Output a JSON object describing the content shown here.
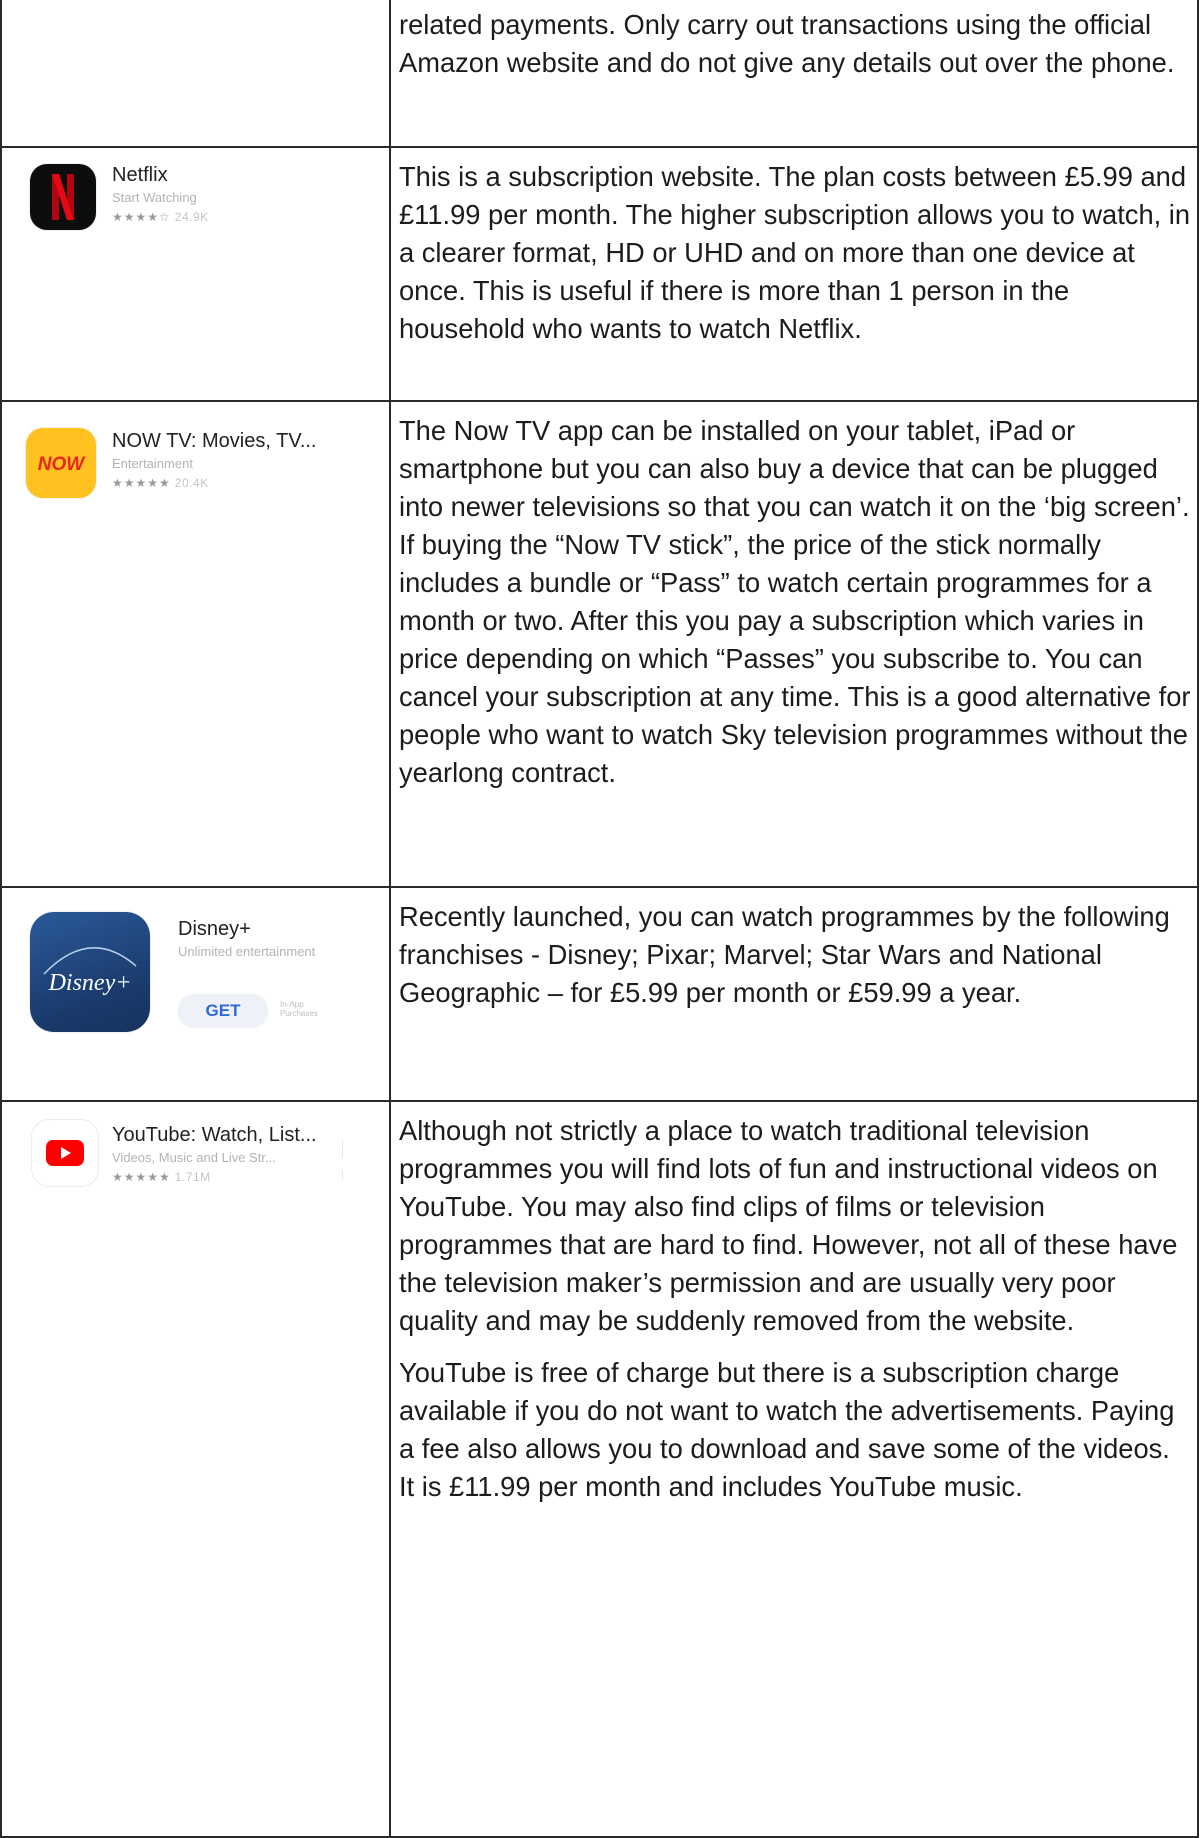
{
  "rows": [
    {
      "paragraphs": [
        "related payments.  Only carry out transactions using the official Amazon website and do not give any details out over the phone."
      ]
    },
    {
      "app": {
        "name": "Netflix",
        "subtitle": "Start Watching",
        "stars": "★★★★☆",
        "rating_count": "24.9K",
        "icon": "netflix-logo",
        "icon_color": "#0d0d0d",
        "accent": "#e50914"
      },
      "paragraphs": [
        "This is a subscription website.  The plan costs between £5.99 and £11.99 per month.  The higher subscription allows you to watch, in a clearer format, HD or UHD and on more than one device at once.  This is useful if there is more than 1 person in the household who wants to watch Netflix."
      ]
    },
    {
      "app": {
        "name": "NOW TV: Movies, TV...",
        "subtitle": "Entertainment",
        "stars": "★★★★★",
        "rating_count": "20.4K",
        "icon": "now-tv-logo",
        "icon_text": "NOW",
        "icon_color": "#ffc21f",
        "accent": "#e8251f"
      },
      "paragraphs": [
        "The Now TV app can be installed on your tablet, iPad or smartphone but you can also buy a device that can be plugged into newer televisions so that you can watch it on the ‘big screen’.  If buying the “Now TV stick”, the price of the stick normally includes a bundle or “Pass” to watch certain programmes for a month or two.  After this you pay a subscription which varies in price depending on which “Passes” you subscribe to.  You can cancel your subscription at any time.  This is a good alternative for people who want to watch Sky television programmes without the yearlong contract."
      ]
    },
    {
      "app": {
        "name": "Disney+",
        "subtitle": "Unlimited entertainment",
        "button": "GET",
        "in_app": "In-App Purchases",
        "icon": "disney-plus-logo",
        "icon_text": "Disney+",
        "icon_color": "#1a3a6b"
      },
      "paragraphs": [
        "Recently launched, you can watch programmes by the following franchises - Disney; Pixar; Marvel; Star Wars and National Geographic – for £5.99 per month or £59.99 a year."
      ]
    },
    {
      "app": {
        "name": "YouTube: Watch, List...",
        "subtitle": "Videos, Music and Live Str...",
        "stars": "★★★★★",
        "rating_count": "1.71M",
        "icon": "youtube-logo",
        "icon_color": "#ffffff",
        "accent": "#ff0000"
      },
      "paragraphs": [
        "Although not strictly a place to watch traditional television programmes you will find lots of fun and instructional videos on YouTube.  You may also find clips of films or television programmes that are hard to find.  However, not all of these have the television maker’s permission and are usually very poor quality and may be suddenly removed from the website.",
        "YouTube is free of charge but there is a subscription charge available if you do not want to watch the advertisements.  Paying a fee also allows you to download and save some of the videos.  It is £11.99 per month and includes YouTube music."
      ]
    }
  ]
}
